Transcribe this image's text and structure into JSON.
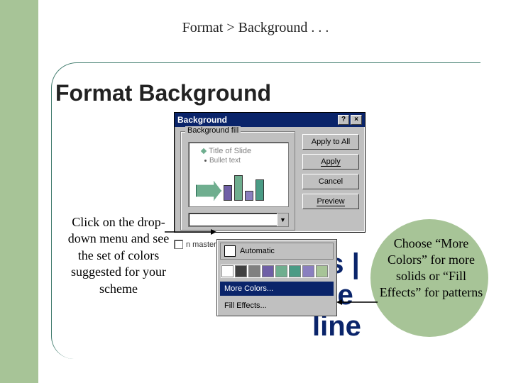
{
  "breadcrumb": "Format > Background . . .",
  "slide_title": "Format Background",
  "dialog": {
    "title": "Background",
    "help_btn": "?",
    "close_btn": "×",
    "group_label": "Background fill",
    "preview": {
      "title_placeholder": "Title of Slide",
      "bullet_placeholder": "Bullet text"
    },
    "buttons": {
      "apply_all": "Apply to All",
      "apply": "Apply",
      "cancel": "Cancel",
      "preview": "Preview"
    },
    "omit_label": "n master"
  },
  "color_popup": {
    "automatic": "Automatic",
    "swatches": [
      "#ffffff",
      "#404040",
      "#808080",
      "#6f5fa6",
      "#6fae8f",
      "#4a9b85",
      "#8a7fbf",
      "#a7c497"
    ],
    "more_colors": "More Colors...",
    "fill_effects": "Fill Effects..."
  },
  "callouts": {
    "left": "Click on the drop-down menu and see the set of colors suggested for your scheme",
    "right": "Choose “More Colors” for more solids or “Fill Effects” for patterns"
  },
  "bg_fragment": "es |\nide\nline"
}
